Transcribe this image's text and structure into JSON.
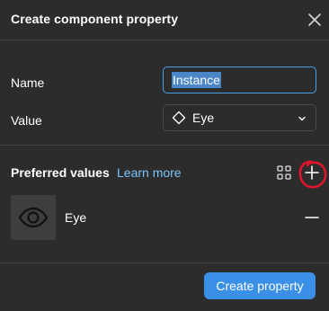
{
  "dialog": {
    "title": "Create component property",
    "close_icon": "close-icon"
  },
  "form": {
    "name_label": "Name",
    "name_value": "Instance",
    "value_label": "Value",
    "value_selected": "Eye",
    "value_icon": "component-diamond-icon"
  },
  "preferred": {
    "label": "Preferred values",
    "learn_more": "Learn more",
    "items": [
      {
        "label": "Eye",
        "icon": "eye-icon"
      }
    ]
  },
  "footer": {
    "create_label": "Create property"
  },
  "colors": {
    "background": "#2c2c2c",
    "accent": "#3a8fe6",
    "link": "#7cc4fa",
    "annotation": "#e0142a"
  }
}
